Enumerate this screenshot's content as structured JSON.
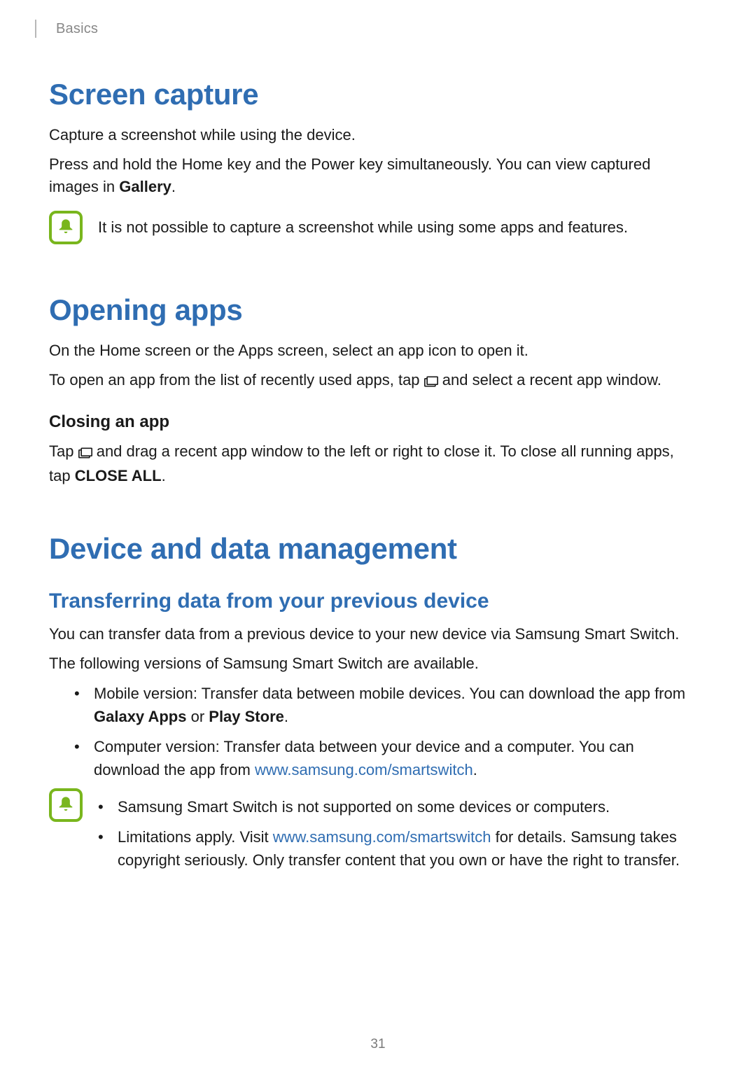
{
  "breadcrumb": "Basics",
  "page_number": "31",
  "screen_capture": {
    "heading": "Screen capture",
    "p1": "Capture a screenshot while using the device.",
    "p2_a": "Press and hold the Home key and the Power key simultaneously. You can view captured images in ",
    "p2_b": "Gallery",
    "p2_c": ".",
    "note": "It is not possible to capture a screenshot while using some apps and features."
  },
  "opening_apps": {
    "heading": "Opening apps",
    "p1": "On the Home screen or the Apps screen, select an app icon to open it.",
    "p2_a": "To open an app from the list of recently used apps, tap ",
    "p2_b": " and select a recent app window.",
    "closing_heading": "Closing an app",
    "closing_a": "Tap ",
    "closing_b": " and drag a recent app window to the left or right to close it. To close all running apps, tap ",
    "closing_c": "CLOSE ALL",
    "closing_d": "."
  },
  "device_data": {
    "heading": "Device and data management",
    "transfer_heading": "Transferring data from your previous device",
    "p1": "You can transfer data from a previous device to your new device via Samsung Smart Switch.",
    "p2": "The following versions of Samsung Smart Switch are available.",
    "bullet1_a": "Mobile version: Transfer data between mobile devices. You can download the app from ",
    "bullet1_b": "Galaxy Apps",
    "bullet1_c": " or ",
    "bullet1_d": "Play Store",
    "bullet1_e": ".",
    "bullet2_a": "Computer version: Transfer data between your device and a computer. You can download the app from ",
    "bullet2_link": "www.samsung.com/smartswitch",
    "bullet2_b": ".",
    "note_bullet1": "Samsung Smart Switch is not supported on some devices or computers.",
    "note_bullet2_a": "Limitations apply. Visit ",
    "note_bullet2_link": "www.samsung.com/smartswitch",
    "note_bullet2_b": " for details. Samsung takes copyright seriously. Only transfer content that you own or have the right to transfer."
  }
}
